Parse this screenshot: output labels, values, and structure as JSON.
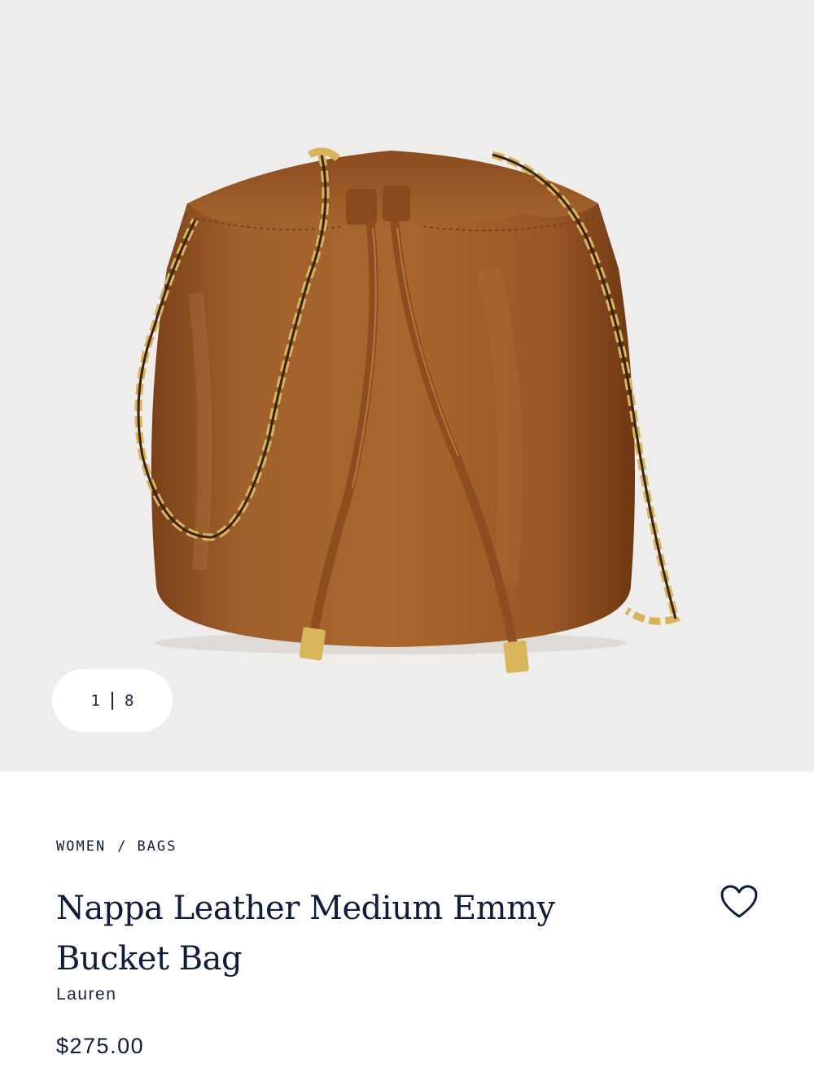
{
  "gallery": {
    "image_alt": "Brown nappa leather bucket bag with gold chain strap and drawstring",
    "counter": {
      "current": "1",
      "total": "8"
    }
  },
  "breadcrumb": {
    "items": [
      "WOMEN",
      "BAGS"
    ],
    "separator": "/"
  },
  "product": {
    "title": "Nappa Leather Medium Emmy Bucket Bag",
    "brand": "Lauren",
    "price": "$275.00"
  },
  "icons": {
    "favorite": "heart-icon"
  },
  "colors": {
    "text": "#0f1d3a",
    "gallery_bg": "#efedeb",
    "leather": "#9c5a2a",
    "gold": "#d8b45a"
  }
}
